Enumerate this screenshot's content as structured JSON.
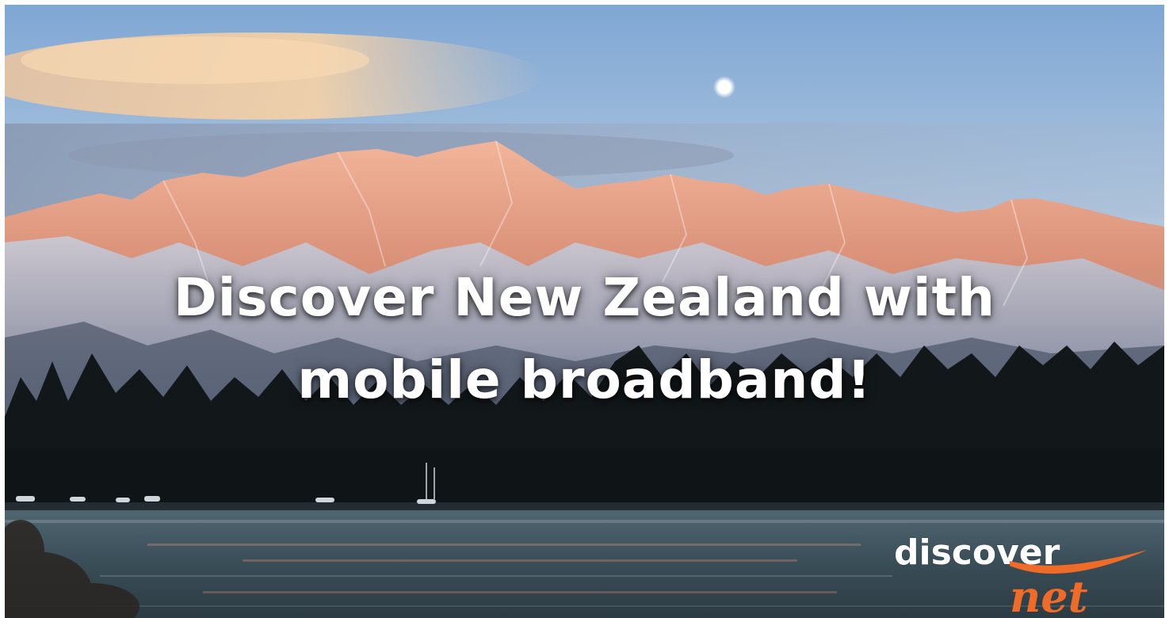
{
  "banner": {
    "headline_line1": "Discover New Zealand with",
    "headline_line2": "mobile broadband!"
  },
  "logo": {
    "word_top": "discover",
    "word_bottom": "net",
    "accent_color": "#f06a28",
    "text_color": "#ffffff"
  },
  "colors": {
    "sky_top": "#7fa7d4",
    "sky_bottom": "#c4d3e0",
    "cloud": "#f5cfa3",
    "alpenglow": "#e9a081",
    "snow": "#dfe4ee",
    "forest": "#101517",
    "water": "#3d545f"
  }
}
